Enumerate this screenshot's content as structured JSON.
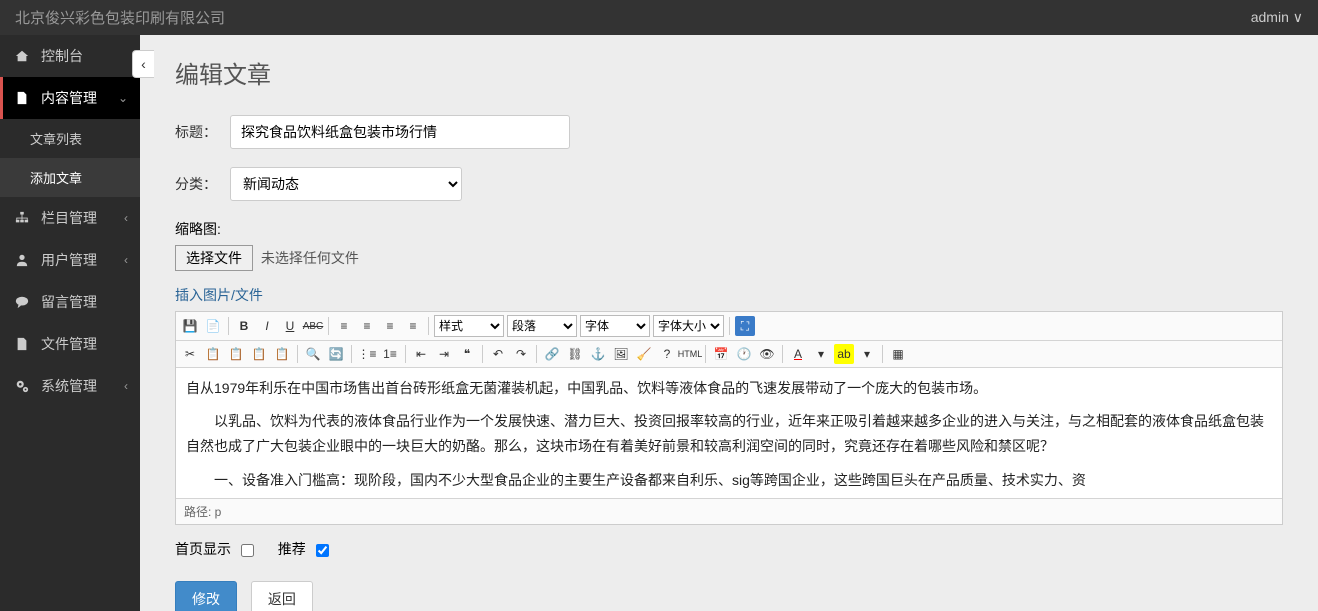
{
  "header": {
    "brand": "北京俊兴彩色包装印刷有限公司",
    "user": "admin"
  },
  "sidebar": {
    "items": [
      {
        "icon": "dashboard",
        "label": "控制台",
        "expandable": false
      },
      {
        "icon": "file",
        "label": "内容管理",
        "expandable": true,
        "open": true,
        "active": true,
        "children": [
          {
            "label": "文章列表",
            "selected": false
          },
          {
            "label": "添加文章",
            "selected": true
          }
        ]
      },
      {
        "icon": "sitemap",
        "label": "栏目管理",
        "expandable": true
      },
      {
        "icon": "user",
        "label": "用户管理",
        "expandable": true
      },
      {
        "icon": "comment",
        "label": "留言管理",
        "expandable": false
      },
      {
        "icon": "folder",
        "label": "文件管理",
        "expandable": false
      },
      {
        "icon": "gears",
        "label": "系统管理",
        "expandable": true
      }
    ]
  },
  "page": {
    "title": "编辑文章"
  },
  "form": {
    "title_label": "标题：",
    "title_value": "探究食品饮料纸盒包装市场行情",
    "category_label": "分类：",
    "category_value": "新闻动态",
    "category_options": [
      "新闻动态"
    ],
    "thumb_label": "缩略图:",
    "choose_file_btn": "选择文件",
    "no_file": "未选择任何文件",
    "insert_link": "插入图片/文件",
    "homepage_label": "首页显示",
    "homepage_checked": false,
    "recommend_label": "推荐",
    "recommend_checked": true,
    "submit_btn": "修改",
    "back_btn": "返回"
  },
  "editor": {
    "toolbar1": {
      "style_label": "样式",
      "format_label": "段落",
      "font_label": "字体",
      "size_label": "字体大小"
    },
    "path_label": "路径: p",
    "content": {
      "p1": "自从1979年利乐在中国市场售出首台砖形纸盒无菌灌装机起，中国乳品、饮料等液体食品的飞速发展带动了一个庞大的包装市场。",
      "p2": "以乳品、饮料为代表的液体食品行业作为一个发展快速、潜力巨大、投资回报率较高的行业，近年来正吸引着越来越多企业的进入与关注，与之相配套的液体食品纸盒包装自然也成了广大包装企业眼中的一块巨大的奶酪。那么，这块市场在有着美好前景和较高利润空间的同时，究竟还存在着哪些风险和禁区呢？",
      "p3": "一、设备准入门槛高：现阶段，国内不少大型食品企业的主要生产设备都来自利乐、sig等跨国企业，这些跨国巨头在产品质量、技术实力、资"
    }
  }
}
